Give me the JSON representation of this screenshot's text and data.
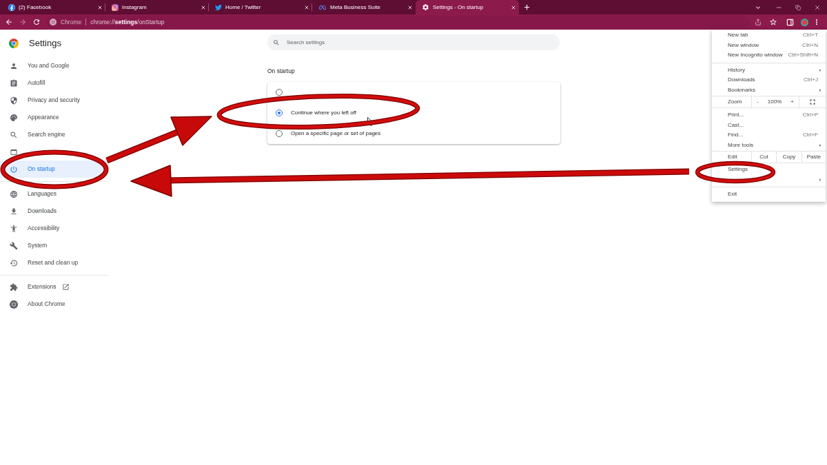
{
  "tabs": [
    {
      "title": "(2) Facebook",
      "selected": false
    },
    {
      "title": "Instagram",
      "selected": false
    },
    {
      "title": "Home / Twitter",
      "selected": false
    },
    {
      "title": "Meta Business Suite",
      "selected": false
    },
    {
      "title": "Settings - On startup",
      "selected": true
    }
  ],
  "nav": [
    {
      "kind": "back",
      "disabled": false
    },
    {
      "kind": "forward",
      "disabled": true
    },
    {
      "kind": "reload",
      "disabled": false
    }
  ],
  "omnibox": {
    "site_label": "Chrome",
    "url": "chrome://**settings**/onStartup"
  },
  "sidebar": {
    "title": "Settings",
    "groups": [
      {
        "items": [
          {
            "label": "You and Google",
            "selected": false,
            "external": false
          },
          {
            "label": "Autofill",
            "selected": false,
            "external": false
          },
          {
            "label": "Privacy and security",
            "selected": false,
            "external": false
          },
          {
            "label": "Appearance",
            "selected": false,
            "external": false
          },
          {
            "label": "Search engine",
            "selected": false,
            "external": false
          },
          {
            "selected": false,
            "external": false
          },
          {
            "label": "On startup",
            "selected": true,
            "external": false
          }
        ]
      },
      {
        "items": [
          {
            "label": "Languages",
            "selected": false,
            "external": false
          },
          {
            "label": "Downloads",
            "selected": false,
            "external": false
          },
          {
            "label": "Accessibility",
            "selected": false,
            "external": false
          },
          {
            "label": "System",
            "selected": false,
            "external": false
          },
          {
            "label": "Reset and clean up",
            "selected": false,
            "external": false
          }
        ]
      },
      {
        "items": [
          {
            "label": "Extensions",
            "selected": false,
            "external": true
          },
          {
            "label": "About Chrome",
            "selected": false,
            "external": false
          }
        ]
      }
    ]
  },
  "search": {
    "placeholder": "Search settings"
  },
  "section": {
    "title": "On startup",
    "options": [
      {
        "selected": false
      },
      {
        "label": "Continue where you left off",
        "selected": true
      },
      {
        "label": "Open a specific page or set of pages",
        "selected": false
      }
    ]
  },
  "menu": {
    "items": [
      {
        "kind": "item",
        "label": "New tab",
        "shortcut": "Ctrl+T",
        "submenu": false
      },
      {
        "kind": "item",
        "label": "New window",
        "shortcut": "Ctrl+N",
        "submenu": false
      },
      {
        "kind": "item",
        "label": "New Incognito window",
        "shortcut": "Ctrl+Shift+N",
        "submenu": false
      },
      {
        "kind": "separator"
      },
      {
        "kind": "item",
        "label": "History",
        "submenu": true
      },
      {
        "kind": "item",
        "label": "Downloads",
        "shortcut": "Ctrl+J",
        "submenu": false
      },
      {
        "kind": "item",
        "label": "Bookmarks",
        "submenu": true
      },
      {
        "kind": "zoom",
        "label": "Zoom",
        "minus": "-",
        "value": "100%",
        "plus": "+"
      },
      {
        "kind": "item",
        "label": "Print...",
        "shortcut": "Ctrl+P",
        "submenu": false
      },
      {
        "kind": "item",
        "label": "Cast...",
        "submenu": false
      },
      {
        "kind": "item",
        "label": "Find...",
        "shortcut": "Ctrl+F",
        "submenu": false
      },
      {
        "kind": "item",
        "label": "More tools",
        "submenu": true
      },
      {
        "kind": "edit",
        "label": "Edit",
        "actions": [
          "Cut",
          "Copy",
          "Paste"
        ]
      },
      {
        "kind": "item",
        "label": "Settings",
        "submenu": false
      },
      {
        "kind": "item",
        "submenu": true
      },
      {
        "kind": "separator"
      },
      {
        "kind": "item",
        "label": "Exit",
        "submenu": false
      }
    ]
  }
}
